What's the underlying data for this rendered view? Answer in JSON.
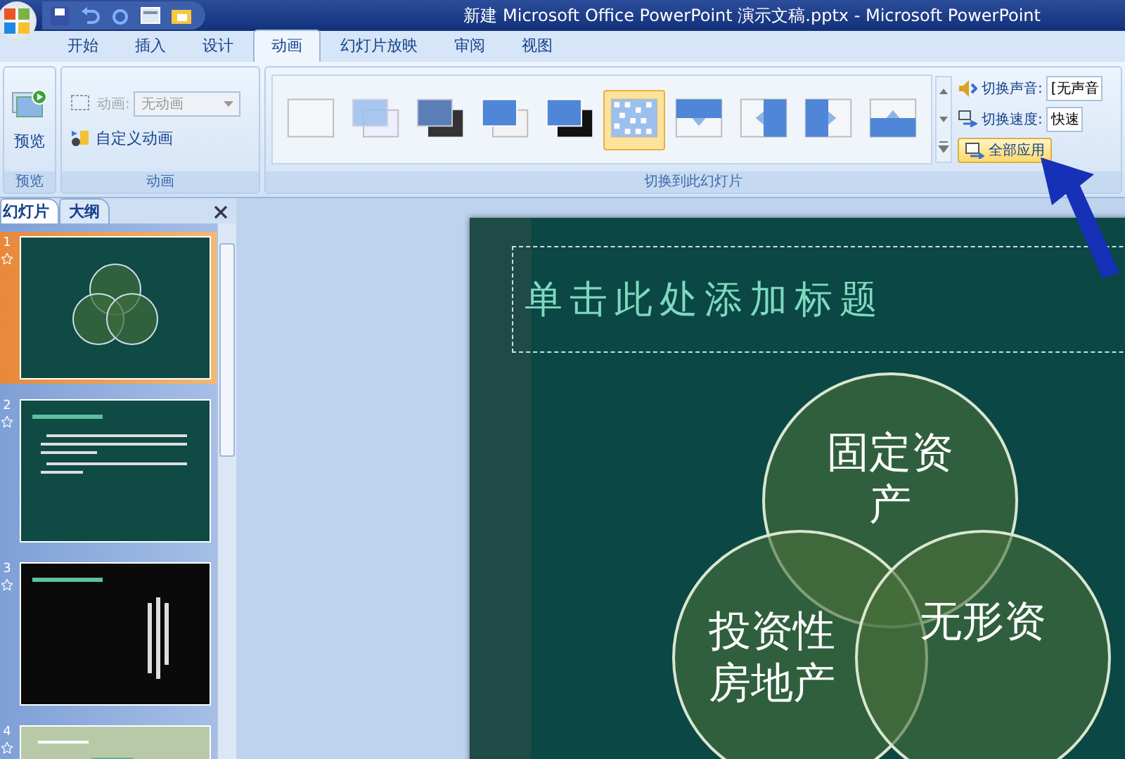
{
  "window": {
    "title": "新建 Microsoft Office PowerPoint 演示文稿.pptx - Microsoft PowerPoint"
  },
  "tabs": [
    {
      "label": "开始",
      "selected": false
    },
    {
      "label": "插入",
      "selected": false
    },
    {
      "label": "设计",
      "selected": false
    },
    {
      "label": "动画",
      "selected": true
    },
    {
      "label": "幻灯片放映",
      "selected": false
    },
    {
      "label": "审阅",
      "selected": false
    },
    {
      "label": "视图",
      "selected": false
    }
  ],
  "ribbon": {
    "preview": {
      "button": "预览",
      "group": "预览"
    },
    "animation": {
      "label": "动画:",
      "value": "无动画",
      "disabled": true,
      "custom": "自定义动画",
      "group": "动画"
    },
    "transition": {
      "group": "切换到此幻灯片",
      "gallery": [
        {
          "kind": "none",
          "selected": false
        },
        {
          "kind": "fade",
          "selected": false
        },
        {
          "kind": "black",
          "selected": false
        },
        {
          "kind": "cut",
          "selected": false
        },
        {
          "kind": "cutblack",
          "selected": false
        },
        {
          "kind": "dissolve",
          "selected": true
        },
        {
          "kind": "down",
          "selected": false
        },
        {
          "kind": "left",
          "selected": false
        },
        {
          "kind": "right",
          "selected": false
        },
        {
          "kind": "up",
          "selected": false
        }
      ],
      "sound_label": "切换声音:",
      "sound_value": "[无声音",
      "speed_label": "切换速度:",
      "speed_value": "快速",
      "apply_all": "全部应用"
    }
  },
  "pane": {
    "tabs": [
      {
        "label": "幻灯片",
        "selected": true
      },
      {
        "label": "大纲",
        "selected": false
      }
    ],
    "slides": [
      {
        "number": "1",
        "selected": true,
        "kind": "venn"
      },
      {
        "number": "2",
        "selected": false,
        "kind": "text"
      },
      {
        "number": "3",
        "selected": false,
        "kind": "dark"
      },
      {
        "number": "4",
        "selected": false,
        "kind": "light"
      }
    ]
  },
  "slide": {
    "title_placeholder": "单击此处添加标题",
    "venn": [
      "固定资产",
      "投资性房地产",
      "无形资"
    ]
  }
}
